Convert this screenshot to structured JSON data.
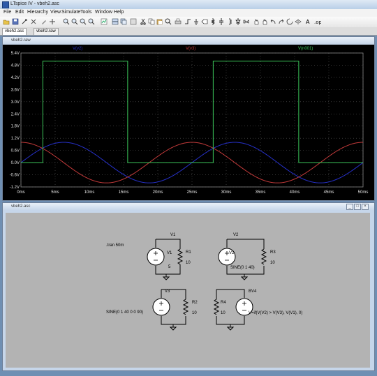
{
  "app": {
    "title": "LTspice IV - vbeh2.asc"
  },
  "menu": [
    "File",
    "Edit",
    "Hierarchy",
    "View",
    "Simulate",
    "Tools",
    "Window",
    "Help"
  ],
  "tabs": [
    {
      "label": "vbeh2.asc"
    },
    {
      "label": "vbeh2.raw"
    }
  ],
  "waveform_window": {
    "title": "vbeh2.raw",
    "traces": [
      {
        "name": "V(v2)",
        "color": "#2630c8"
      },
      {
        "name": "V(v3)",
        "color": "#c23a3a"
      },
      {
        "name": "V(n001)",
        "color": "#3cc85a"
      }
    ]
  },
  "schematic_window": {
    "title": "vbeh2.asc",
    "directive": ".tran 50m",
    "labels": {
      "V1": "V1",
      "V1_val": "5",
      "R1": "R1",
      "R1_val": "10",
      "V2": "V2",
      "V2_val": "SINE(0 1 40)",
      "R3": "R3",
      "R3_val": "10",
      "V3": "V3",
      "V3_val": "SINE(0 1 40 0 0 90)",
      "R2": "R2",
      "R2_val": "10",
      "R4": "R4",
      "R4_val": "10",
      "BV4": "BV4",
      "BV4_expr": "V=if(V(V2) > V(V3), V(V1), 0)"
    }
  },
  "chart_data": {
    "type": "line",
    "title": "",
    "xlabel": "",
    "ylabel": "",
    "x_ticks": [
      "0ms",
      "5ms",
      "10ms",
      "15ms",
      "20ms",
      "25ms",
      "30ms",
      "35ms",
      "40ms",
      "45ms",
      "50ms"
    ],
    "y_ticks": [
      "5.4V",
      "4.8V",
      "4.2V",
      "3.6V",
      "3.0V",
      "2.4V",
      "1.8V",
      "1.2V",
      "0.6V",
      "0.0V",
      "-0.6V",
      "-1.2V"
    ],
    "xlim": [
      0,
      50
    ],
    "ylim": [
      -1.2,
      5.4
    ],
    "grid": true,
    "series": [
      {
        "name": "V(v2)",
        "function": "sine",
        "amplitude": 1,
        "freq_hz": 40,
        "phase_deg": 0,
        "color": "#2630c8"
      },
      {
        "name": "V(v3)",
        "function": "sine",
        "amplitude": 1,
        "freq_hz": 40,
        "phase_deg": 90,
        "color": "#c23a3a"
      },
      {
        "name": "V(n001)",
        "function": "step",
        "x": [
          0,
          3.2,
          3.2,
          15.6,
          15.6,
          28.1,
          28.1,
          40.6,
          40.6,
          50
        ],
        "y": [
          0,
          0,
          5,
          5,
          0,
          0,
          5,
          5,
          0,
          0
        ],
        "color": "#3cc85a"
      }
    ]
  }
}
